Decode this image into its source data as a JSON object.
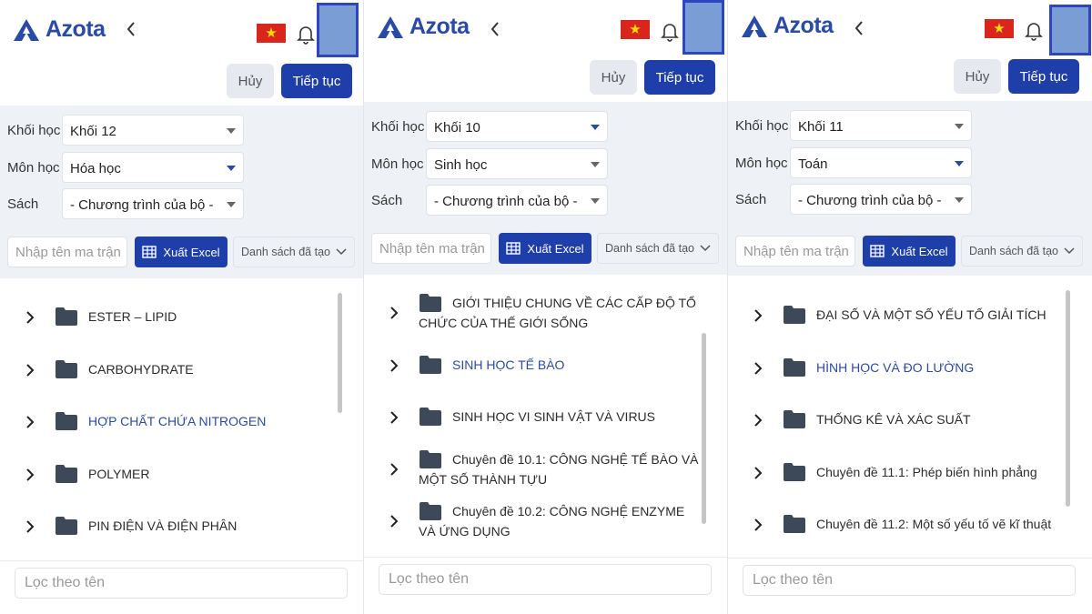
{
  "panels": [
    {
      "header": {
        "logo": "Azota",
        "back_icon": "chevron-left-icon",
        "flag_icon": "vietnam-flag-icon",
        "bell_icon": "bell-icon"
      },
      "actions": {
        "cancel": "Hủy",
        "continue": "Tiếp tục"
      },
      "filters": {
        "grade_label": "Khối học",
        "grade_value": "Khối 12",
        "subject_label": "Môn học",
        "subject_value": "Hóa học",
        "book_label": "Sách",
        "book_value": "- Chương trình của bộ -"
      },
      "search": {
        "placeholder": "Nhập tên ma trận",
        "excel": "Xuất Excel",
        "list": "Danh sách đã tạo"
      },
      "tree": [
        {
          "label": "ESTER – LIPID"
        },
        {
          "label": "CARBOHYDRATE"
        },
        {
          "label": "HỢP CHẤT CHỨA NITROGEN",
          "highlighted": true
        },
        {
          "label": "POLYMER"
        },
        {
          "label": "PIN ĐIỆN VÀ ĐIỆN PHÂN"
        }
      ],
      "filter_placeholder": "Lọc theo tên"
    },
    {
      "header": {
        "logo": "Azota",
        "back_icon": "chevron-left-icon",
        "flag_icon": "vietnam-flag-icon",
        "bell_icon": "bell-icon"
      },
      "actions": {
        "cancel": "Hủy",
        "continue": "Tiếp tục"
      },
      "filters": {
        "grade_label": "Khối học",
        "grade_value": "Khối 10",
        "subject_label": "Môn học",
        "subject_value": "Sinh học",
        "book_label": "Sách",
        "book_value": "- Chương trình của bộ -"
      },
      "search": {
        "placeholder": "Nhập tên ma trận",
        "excel": "Xuất Excel",
        "list": "Danh sách đã tạo"
      },
      "tree": [
        {
          "label": "GIỚI THIỆU CHUNG VỀ CÁC CẤP ĐỘ TỔ CHỨC CỦA THẾ GIỚI SỐNG",
          "wrap": true
        },
        {
          "label": "SINH HỌC TẾ BÀO",
          "highlighted": true
        },
        {
          "label": "SINH HỌC VI SINH VẬT VÀ VIRUS"
        },
        {
          "label": "Chuyên đề 10.1: CÔNG NGHỆ TẾ BÀO VÀ MỘT SỐ THÀNH TỰU",
          "wrap": true
        },
        {
          "label": "Chuyên đề 10.2: CÔNG NGHỆ ENZYME VÀ ỨNG DỤNG",
          "wrap": true
        }
      ],
      "filter_placeholder": "Lọc theo tên"
    },
    {
      "header": {
        "logo": "Azota",
        "back_icon": "chevron-left-icon",
        "flag_icon": "vietnam-flag-icon",
        "bell_icon": "bell-icon"
      },
      "actions": {
        "cancel": "Hủy",
        "continue": "Tiếp tục"
      },
      "filters": {
        "grade_label": "Khối học",
        "grade_value": "Khối 11",
        "subject_label": "Môn học",
        "subject_value": "Toán",
        "book_label": "Sách",
        "book_value": "- Chương trình của bộ -"
      },
      "search": {
        "placeholder": "Nhập tên ma trận",
        "excel": "Xuất Excel",
        "list": "Danh sách đã tạo"
      },
      "tree": [
        {
          "label": "ĐẠI SỐ VÀ MỘT SỐ YẾU TỐ GIẢI TÍCH"
        },
        {
          "label": "HÌNH HỌC VÀ ĐO LƯỜNG",
          "highlighted": true
        },
        {
          "label": "THỐNG KÊ VÀ XÁC SUẤT"
        },
        {
          "label": "Chuyên đề 11.1: Phép biến hình phẳng"
        },
        {
          "label": "Chuyên đề 11.2: Một số yếu tố vẽ kĩ thuật"
        }
      ],
      "filter_placeholder": "Lọc theo tên"
    }
  ],
  "colors": {
    "brand": "#1e3faa",
    "highlight_text": "#2a4aa8",
    "filter_bg": "#eef1f6"
  }
}
